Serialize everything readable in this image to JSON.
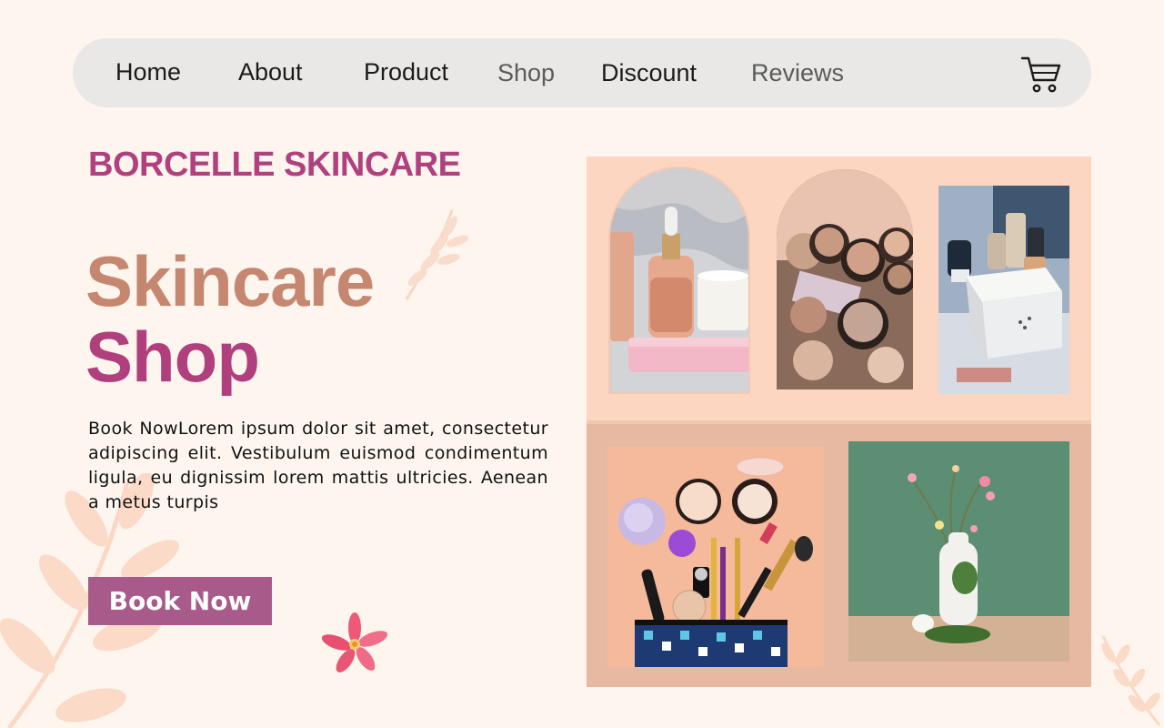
{
  "nav": {
    "items": [
      {
        "label": "Home"
      },
      {
        "label": "About"
      },
      {
        "label": "Product"
      },
      {
        "label": "Shop"
      },
      {
        "label": "Discount"
      },
      {
        "label": "Reviews"
      }
    ],
    "cart_icon": "shopping-cart-icon"
  },
  "brand": "BORCELLE SKINCARE",
  "hero": {
    "line1": "Skincare",
    "line2": "Shop"
  },
  "description": "Book NowLorem ipsum dolor sit amet, consectetur adipiscing elit. Vestibulum euismod condimentum ligula, eu dignissim lorem mattis ultricies. Aenean a metus turpis",
  "cta": {
    "label": "Book Now"
  },
  "colors": {
    "background": "#fdf5ee",
    "nav_background": "#e9e8e6",
    "brand": "#b0417e",
    "hero_line1": "#c58770",
    "hero_line2": "#b0407d",
    "cta_background": "#a85a8b",
    "gallery_top": "#fcd6c0",
    "gallery_bottom": "#e7b9a2"
  },
  "gallery": [
    {
      "name": "serum-bottle-photo"
    },
    {
      "name": "powder-compacts-photo"
    },
    {
      "name": "perfume-bottles-photo"
    },
    {
      "name": "makeup-pouch-photo"
    },
    {
      "name": "vase-flowers-photo"
    }
  ]
}
